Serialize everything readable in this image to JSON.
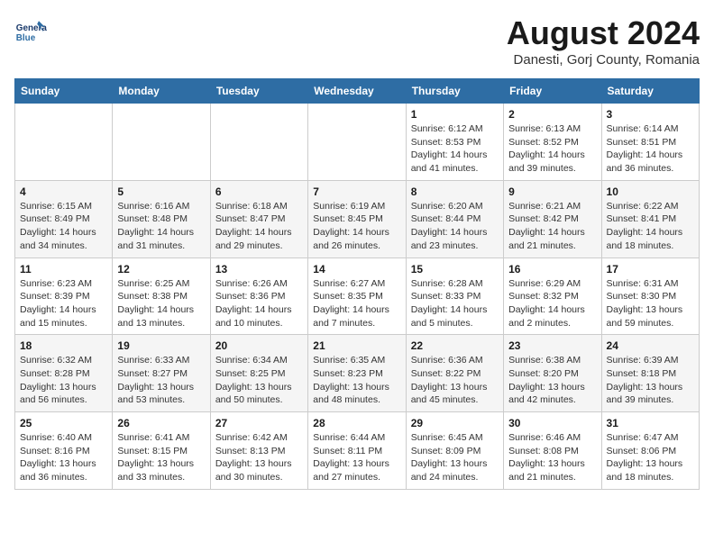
{
  "logo": {
    "line1": "General",
    "line2": "Blue"
  },
  "title": "August 2024",
  "subtitle": "Danesti, Gorj County, Romania",
  "headers": [
    "Sunday",
    "Monday",
    "Tuesday",
    "Wednesday",
    "Thursday",
    "Friday",
    "Saturday"
  ],
  "weeks": [
    [
      {
        "day": "",
        "info": ""
      },
      {
        "day": "",
        "info": ""
      },
      {
        "day": "",
        "info": ""
      },
      {
        "day": "",
        "info": ""
      },
      {
        "day": "1",
        "info": "Sunrise: 6:12 AM\nSunset: 8:53 PM\nDaylight: 14 hours and 41 minutes."
      },
      {
        "day": "2",
        "info": "Sunrise: 6:13 AM\nSunset: 8:52 PM\nDaylight: 14 hours and 39 minutes."
      },
      {
        "day": "3",
        "info": "Sunrise: 6:14 AM\nSunset: 8:51 PM\nDaylight: 14 hours and 36 minutes."
      }
    ],
    [
      {
        "day": "4",
        "info": "Sunrise: 6:15 AM\nSunset: 8:49 PM\nDaylight: 14 hours and 34 minutes."
      },
      {
        "day": "5",
        "info": "Sunrise: 6:16 AM\nSunset: 8:48 PM\nDaylight: 14 hours and 31 minutes."
      },
      {
        "day": "6",
        "info": "Sunrise: 6:18 AM\nSunset: 8:47 PM\nDaylight: 14 hours and 29 minutes."
      },
      {
        "day": "7",
        "info": "Sunrise: 6:19 AM\nSunset: 8:45 PM\nDaylight: 14 hours and 26 minutes."
      },
      {
        "day": "8",
        "info": "Sunrise: 6:20 AM\nSunset: 8:44 PM\nDaylight: 14 hours and 23 minutes."
      },
      {
        "day": "9",
        "info": "Sunrise: 6:21 AM\nSunset: 8:42 PM\nDaylight: 14 hours and 21 minutes."
      },
      {
        "day": "10",
        "info": "Sunrise: 6:22 AM\nSunset: 8:41 PM\nDaylight: 14 hours and 18 minutes."
      }
    ],
    [
      {
        "day": "11",
        "info": "Sunrise: 6:23 AM\nSunset: 8:39 PM\nDaylight: 14 hours and 15 minutes."
      },
      {
        "day": "12",
        "info": "Sunrise: 6:25 AM\nSunset: 8:38 PM\nDaylight: 14 hours and 13 minutes."
      },
      {
        "day": "13",
        "info": "Sunrise: 6:26 AM\nSunset: 8:36 PM\nDaylight: 14 hours and 10 minutes."
      },
      {
        "day": "14",
        "info": "Sunrise: 6:27 AM\nSunset: 8:35 PM\nDaylight: 14 hours and 7 minutes."
      },
      {
        "day": "15",
        "info": "Sunrise: 6:28 AM\nSunset: 8:33 PM\nDaylight: 14 hours and 5 minutes."
      },
      {
        "day": "16",
        "info": "Sunrise: 6:29 AM\nSunset: 8:32 PM\nDaylight: 14 hours and 2 minutes."
      },
      {
        "day": "17",
        "info": "Sunrise: 6:31 AM\nSunset: 8:30 PM\nDaylight: 13 hours and 59 minutes."
      }
    ],
    [
      {
        "day": "18",
        "info": "Sunrise: 6:32 AM\nSunset: 8:28 PM\nDaylight: 13 hours and 56 minutes."
      },
      {
        "day": "19",
        "info": "Sunrise: 6:33 AM\nSunset: 8:27 PM\nDaylight: 13 hours and 53 minutes."
      },
      {
        "day": "20",
        "info": "Sunrise: 6:34 AM\nSunset: 8:25 PM\nDaylight: 13 hours and 50 minutes."
      },
      {
        "day": "21",
        "info": "Sunrise: 6:35 AM\nSunset: 8:23 PM\nDaylight: 13 hours and 48 minutes."
      },
      {
        "day": "22",
        "info": "Sunrise: 6:36 AM\nSunset: 8:22 PM\nDaylight: 13 hours and 45 minutes."
      },
      {
        "day": "23",
        "info": "Sunrise: 6:38 AM\nSunset: 8:20 PM\nDaylight: 13 hours and 42 minutes."
      },
      {
        "day": "24",
        "info": "Sunrise: 6:39 AM\nSunset: 8:18 PM\nDaylight: 13 hours and 39 minutes."
      }
    ],
    [
      {
        "day": "25",
        "info": "Sunrise: 6:40 AM\nSunset: 8:16 PM\nDaylight: 13 hours and 36 minutes."
      },
      {
        "day": "26",
        "info": "Sunrise: 6:41 AM\nSunset: 8:15 PM\nDaylight: 13 hours and 33 minutes."
      },
      {
        "day": "27",
        "info": "Sunrise: 6:42 AM\nSunset: 8:13 PM\nDaylight: 13 hours and 30 minutes."
      },
      {
        "day": "28",
        "info": "Sunrise: 6:44 AM\nSunset: 8:11 PM\nDaylight: 13 hours and 27 minutes."
      },
      {
        "day": "29",
        "info": "Sunrise: 6:45 AM\nSunset: 8:09 PM\nDaylight: 13 hours and 24 minutes."
      },
      {
        "day": "30",
        "info": "Sunrise: 6:46 AM\nSunset: 8:08 PM\nDaylight: 13 hours and 21 minutes."
      },
      {
        "day": "31",
        "info": "Sunrise: 6:47 AM\nSunset: 8:06 PM\nDaylight: 13 hours and 18 minutes."
      }
    ]
  ]
}
